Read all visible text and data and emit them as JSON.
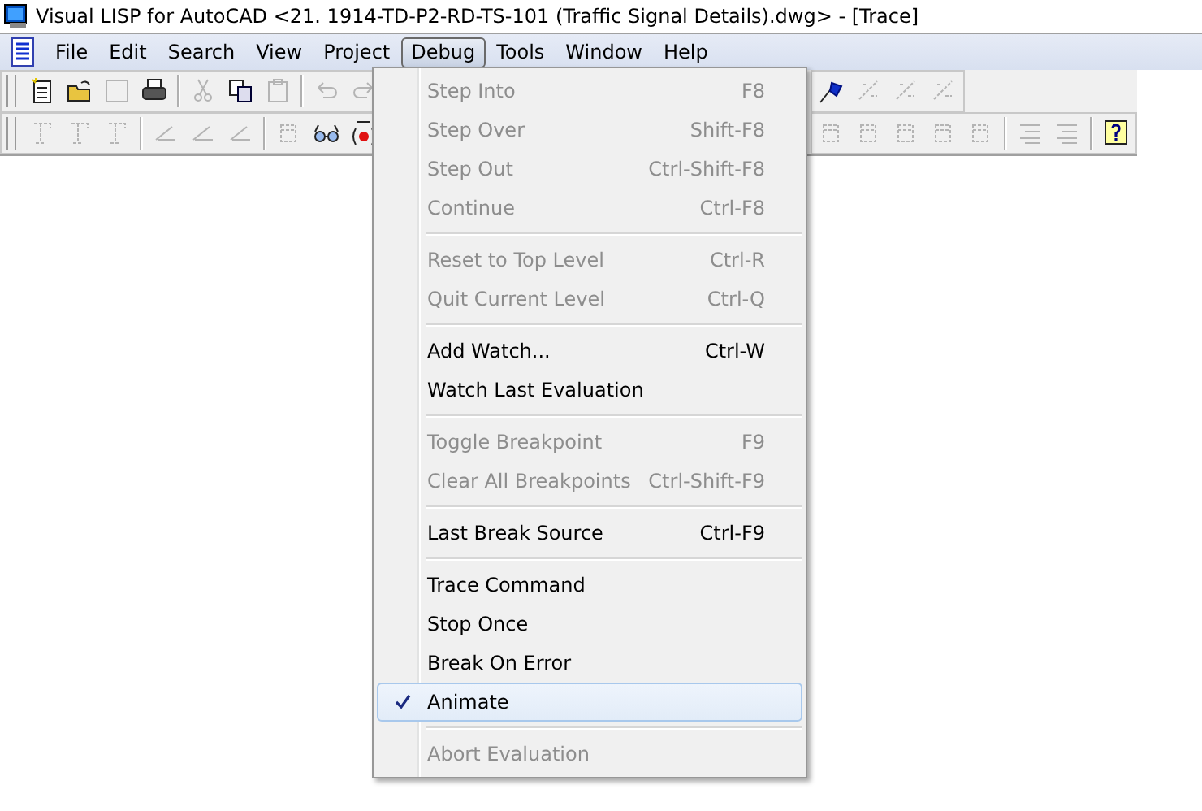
{
  "window": {
    "title": "Visual LISP for AutoCAD <21. 1914-TD-P2-RD-TS-101 (Traffic Signal Details).dwg> - [Trace]"
  },
  "menu_bar": [
    {
      "label": "File",
      "selected": false
    },
    {
      "label": "Edit",
      "selected": false
    },
    {
      "label": "Search",
      "selected": false
    },
    {
      "label": "View",
      "selected": false
    },
    {
      "label": "Project",
      "selected": false
    },
    {
      "label": "Debug",
      "selected": true
    },
    {
      "label": "Tools",
      "selected": false
    },
    {
      "label": "Window",
      "selected": false
    },
    {
      "label": "Help",
      "selected": false
    }
  ],
  "toolbars": [
    {
      "left": [
        [
          {
            "kind": "new",
            "disabled": false
          },
          {
            "kind": "open",
            "disabled": false
          },
          {
            "kind": "save",
            "disabled": true
          },
          {
            "kind": "print",
            "disabled": false
          }
        ],
        [
          {
            "kind": "cut",
            "disabled": true
          },
          {
            "kind": "copy",
            "disabled": false
          },
          {
            "kind": "paste",
            "disabled": true
          }
        ],
        [
          {
            "kind": "undo",
            "disabled": true
          },
          {
            "kind": "redo",
            "disabled": true
          }
        ]
      ],
      "right": [
        [
          {
            "kind": "flag",
            "disabled": false
          },
          {
            "kind": "breakpoint",
            "disabled": true
          },
          {
            "kind": "breakpoint",
            "disabled": true
          },
          {
            "kind": "breakpoint",
            "disabled": true
          }
        ]
      ]
    },
    {
      "left": [
        [
          {
            "kind": "load",
            "disabled": true
          },
          {
            "kind": "load",
            "disabled": true
          },
          {
            "kind": "load",
            "disabled": true
          }
        ],
        [
          {
            "kind": "stroke",
            "disabled": true
          },
          {
            "kind": "stroke",
            "disabled": true
          },
          {
            "kind": "stroke",
            "disabled": true
          }
        ],
        [
          {
            "kind": "window",
            "disabled": true
          },
          {
            "kind": "watch",
            "disabled": false
          },
          {
            "kind": "trace",
            "disabled": false
          }
        ]
      ],
      "right": [
        [
          {
            "kind": "window",
            "disabled": true
          },
          {
            "kind": "window",
            "disabled": true
          },
          {
            "kind": "window",
            "disabled": true
          },
          {
            "kind": "window",
            "disabled": true
          },
          {
            "kind": "window",
            "disabled": true
          }
        ],
        [
          {
            "kind": "lines",
            "disabled": true
          },
          {
            "kind": "lines",
            "disabled": true
          }
        ],
        [
          {
            "kind": "help",
            "disabled": false
          }
        ]
      ]
    }
  ],
  "debug_menu": [
    [
      {
        "label": "Step Into",
        "shortcut": "F8",
        "disabled": true,
        "checked": false,
        "selected": false
      },
      {
        "label": "Step Over",
        "shortcut": "Shift-F8",
        "disabled": true,
        "checked": false,
        "selected": false
      },
      {
        "label": "Step Out",
        "shortcut": "Ctrl-Shift-F8",
        "disabled": true,
        "checked": false,
        "selected": false
      },
      {
        "label": "Continue",
        "shortcut": "Ctrl-F8",
        "disabled": true,
        "checked": false,
        "selected": false
      }
    ],
    [
      {
        "label": "Reset to Top Level",
        "shortcut": "Ctrl-R",
        "disabled": true,
        "checked": false,
        "selected": false
      },
      {
        "label": "Quit Current Level",
        "shortcut": "Ctrl-Q",
        "disabled": true,
        "checked": false,
        "selected": false
      }
    ],
    [
      {
        "label": "Add Watch...",
        "shortcut": "Ctrl-W",
        "disabled": false,
        "checked": false,
        "selected": false
      },
      {
        "label": "Watch Last Evaluation",
        "disabled": false,
        "checked": false,
        "selected": false
      }
    ],
    [
      {
        "label": "Toggle Breakpoint",
        "shortcut": "F9",
        "disabled": true,
        "checked": false,
        "selected": false
      },
      {
        "label": "Clear All Breakpoints",
        "shortcut": "Ctrl-Shift-F9",
        "disabled": true,
        "checked": false,
        "selected": false
      }
    ],
    [
      {
        "label": "Last Break Source",
        "shortcut": "Ctrl-F9",
        "disabled": false,
        "checked": false,
        "selected": false
      }
    ],
    [
      {
        "label": "Trace Command",
        "disabled": false,
        "checked": false,
        "selected": false
      },
      {
        "label": "Stop Once",
        "disabled": false,
        "checked": false,
        "selected": false
      },
      {
        "label": "Break On Error",
        "disabled": false,
        "checked": false,
        "selected": false
      },
      {
        "label": "Animate",
        "disabled": false,
        "checked": true,
        "selected": true
      }
    ],
    [
      {
        "label": "Abort Evaluation",
        "disabled": true,
        "checked": false,
        "selected": false
      }
    ]
  ]
}
